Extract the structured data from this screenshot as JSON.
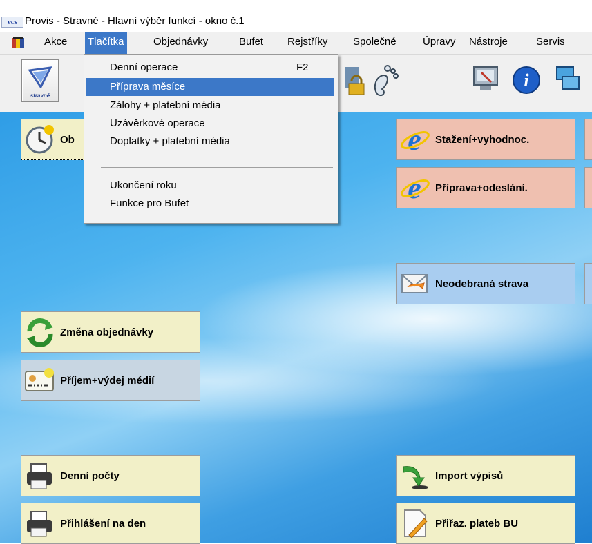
{
  "window": {
    "title": "Provis - Stravné - Hlavní výběr funkcí - okno č.1",
    "logo_text": "vcs"
  },
  "menubar": [
    {
      "label": "Akce"
    },
    {
      "label": "Tlačítka"
    },
    {
      "label": "Objednávky"
    },
    {
      "label": "Bufet"
    },
    {
      "label": "Rejstříky"
    },
    {
      "label": "Společné"
    },
    {
      "label": "Úpravy"
    },
    {
      "label": "Nástroje"
    },
    {
      "label": "Servis"
    }
  ],
  "toolbar": {
    "main_label": "stravné"
  },
  "dropdown": {
    "items": [
      {
        "label": "Denní operace",
        "shortcut": "F2"
      },
      {
        "label": "Příprava měsíce",
        "shortcut": ""
      },
      {
        "label": "Zálohy + platební média",
        "shortcut": ""
      },
      {
        "label": "Uzávěrkové operace",
        "shortcut": ""
      },
      {
        "label": "Doplatky + platební média",
        "shortcut": ""
      },
      {
        "label": "Ukončení roku",
        "shortcut": ""
      },
      {
        "label": "Funkce pro Bufet",
        "shortcut": ""
      }
    ]
  },
  "desktop": {
    "obj_partial": "Ob",
    "stazeni": "Stažení+vyhodnoc.",
    "priprava": "Příprava+odeslání.",
    "neodebrana": "Neodebraná strava",
    "zmena": "Změna objednávky",
    "prijem": "Příjem+výdej médií",
    "denni_pocty": "Denní počty",
    "import": "Import výpisů",
    "prihlaseni": "Přihlášení na den",
    "prirazeni": "Přiřaz. plateb BU"
  },
  "colors": {
    "menu_highlight": "#3c78c8",
    "btn_yellow": "#f2f0c8",
    "btn_salmon": "#efc0b0",
    "btn_blue": "#a9cdf0"
  }
}
